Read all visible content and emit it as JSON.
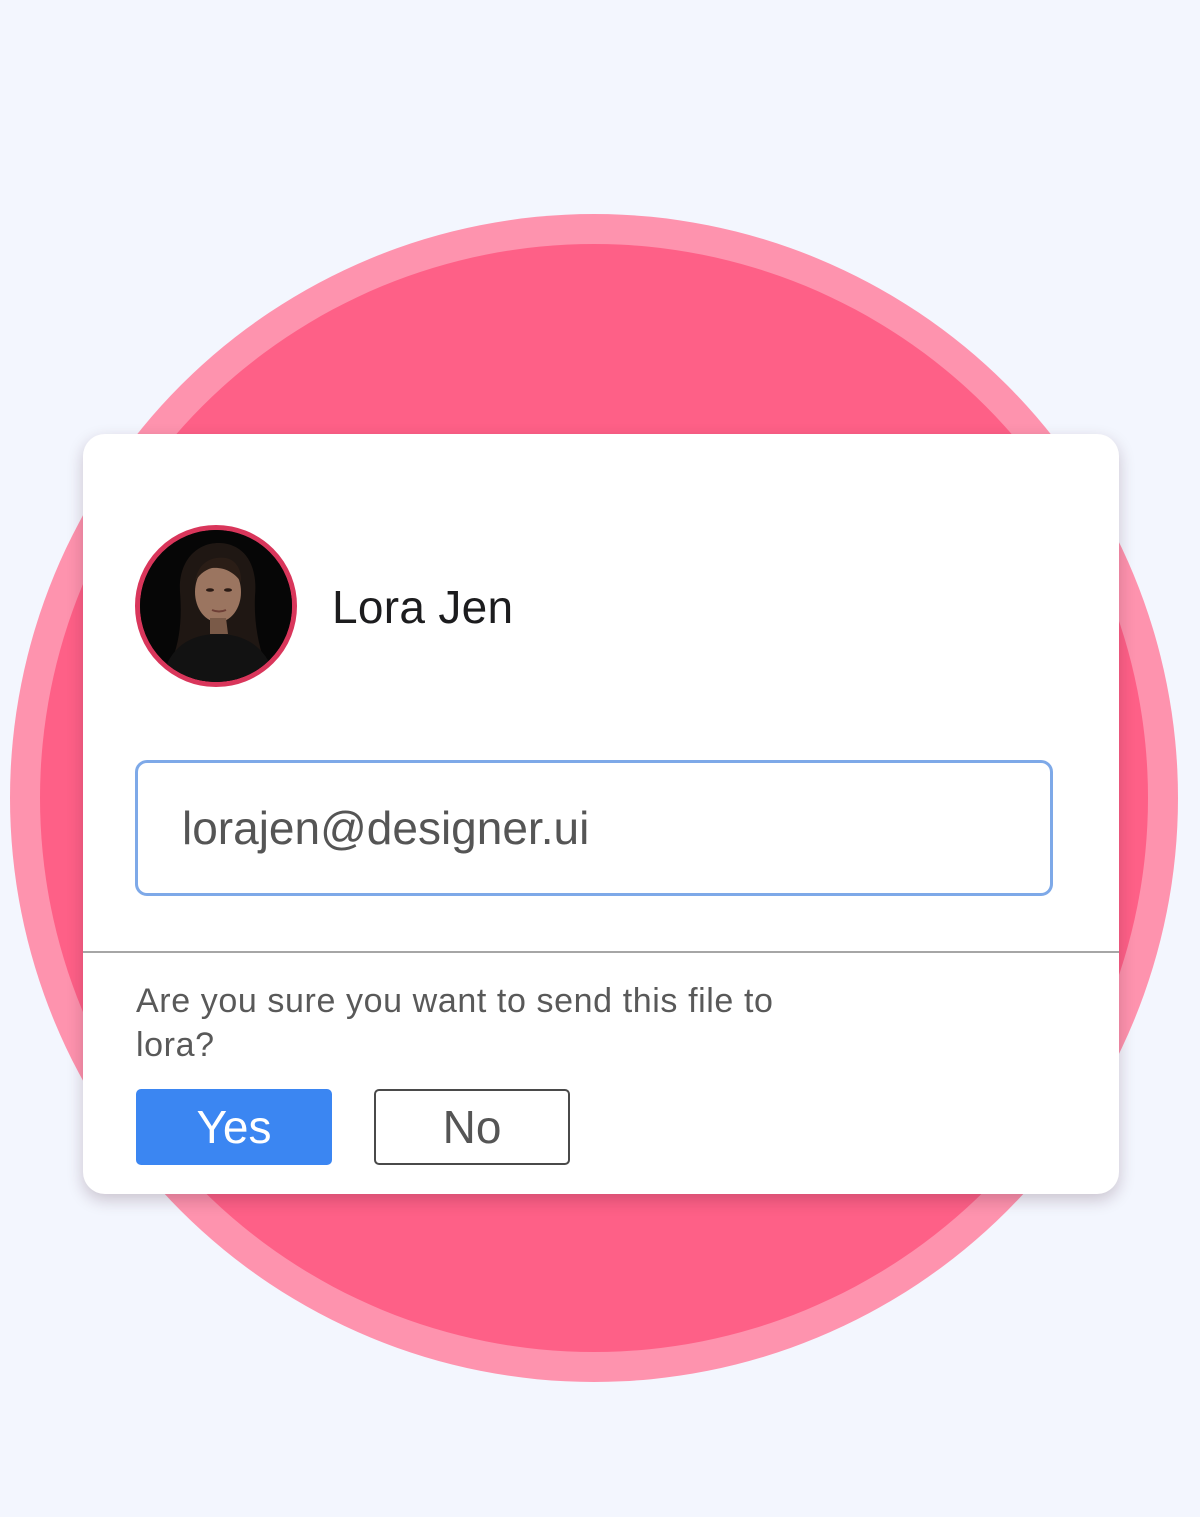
{
  "user": {
    "name": "Lora Jen"
  },
  "email_field": {
    "value": "lorajen@designer.ui"
  },
  "confirmation": {
    "message": "Are you sure you want to send this file to lora?"
  },
  "actions": {
    "yes_label": "Yes",
    "no_label": "No"
  },
  "colors": {
    "page_background": "#f3f6fe",
    "circle_outer": "#fe93ae",
    "circle_inner": "#fe6087",
    "avatar_ring": "#d9365b",
    "input_border": "#7ea9e8",
    "primary_button": "#3b86f2"
  }
}
